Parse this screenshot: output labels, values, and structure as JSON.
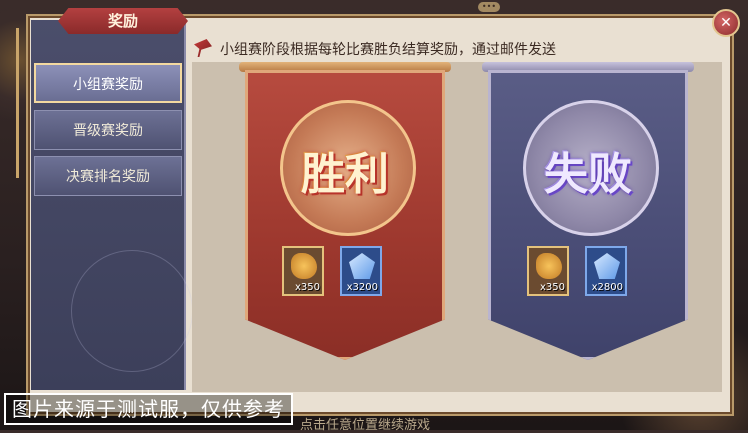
{
  "window": {
    "title": "奖励",
    "close_icon": "close-icon"
  },
  "sidebar": {
    "items": [
      {
        "label": "小组赛奖励",
        "active": true
      },
      {
        "label": "晋级赛奖励",
        "active": false
      },
      {
        "label": "决赛排名奖励",
        "active": false
      }
    ]
  },
  "notice": {
    "icon": "axe-icon",
    "text": "小组赛阶段根据每轮比赛胜负结算奖励，通过邮件发送"
  },
  "banners": [
    {
      "id": "win",
      "result": "胜利",
      "rewards": [
        {
          "icon": "gold-coin-icon",
          "qty": "x350"
        },
        {
          "icon": "crystal-icon",
          "qty": "x3200"
        }
      ]
    },
    {
      "id": "lose",
      "result": "失败",
      "rewards": [
        {
          "icon": "gold-coin-icon",
          "qty": "x350"
        },
        {
          "icon": "crystal-icon",
          "qty": "x2800"
        }
      ]
    }
  ],
  "bottom_hint": "点击任意位置继续游戏",
  "watermark": "图片来源于测试服，仅供参考",
  "top_dots": "•••",
  "colors": {
    "win_banner": "#a8443a",
    "lose_banner": "#4f5279",
    "sidebar": "#4b4e6b",
    "panel": "#e9e0d2"
  }
}
